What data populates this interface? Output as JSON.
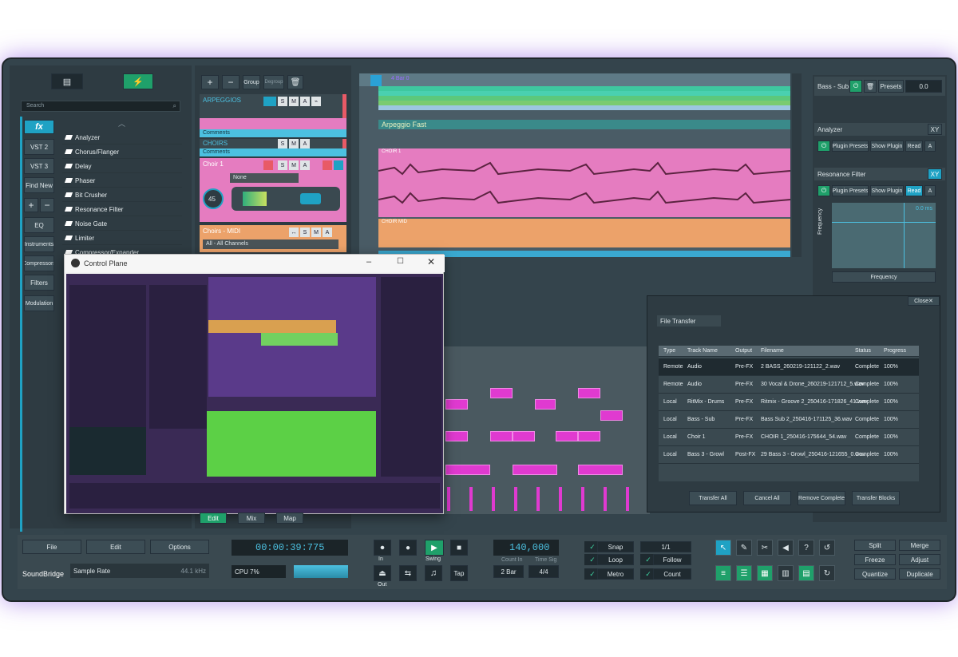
{
  "app": {
    "brand": "SoundBridge",
    "accent": "#1fa2c4",
    "green": "#1fa06a",
    "pink": "#e57cc0",
    "magenta": "#e03ad0"
  },
  "browser": {
    "search_placeholder": "Search",
    "categories": [
      "VST 2",
      "VST 3",
      "Find New",
      "EQ",
      "Instruments",
      "Compressors",
      "Filters",
      "Modulation"
    ],
    "fx_label": "fx",
    "plugins": [
      "Analyzer",
      "Chorus/Flanger",
      "Delay",
      "Phaser",
      "Bit Crusher",
      "Resonance Filter",
      "Noise Gate",
      "Limiter",
      "Compressor/Expander"
    ]
  },
  "tracks_toolbar": {
    "add": "+",
    "remove": "−",
    "group": "Group",
    "degroup": "Degroup",
    "trash": "trash-icon"
  },
  "tracks": {
    "arpeggios": {
      "name": "ARPEGGIOS",
      "comments": "Comments"
    },
    "choirs": {
      "name": "CHOIRS",
      "comments": "Comments"
    },
    "choir1": {
      "name": "Choir 1",
      "input": "None",
      "pan": "45"
    },
    "choirs_midi": {
      "name": "Choirs - MIDI",
      "channels": "All - All Channels"
    },
    "buttons": [
      "S",
      "M",
      "A"
    ]
  },
  "arrange": {
    "loop_label": "4 Bar 0",
    "clip_arpeggio": "Arpeggio Fast",
    "clip_choir": "CHOIR 1",
    "clip_choir_midi": "CHOIR MID"
  },
  "control_plane": {
    "title": "Control Plane"
  },
  "right": {
    "track": "Bass - Sub",
    "presets": "Presets",
    "preset_value": "0.0",
    "analyzer": "Analyzer",
    "xy": "XY",
    "plugin_presets": "Plugin Presets",
    "show_plugin": "Show Plugin",
    "read": "Read",
    "a": "A",
    "resonance": "Resonance Filter",
    "frequency": "Frequency",
    "freq_axis": "Frequency",
    "ms": "0.0 ms"
  },
  "file_transfer": {
    "close": "Close",
    "title": "File Transfer",
    "headers": [
      "Type",
      "Track Name",
      "Output",
      "Filename",
      "Status",
      "Progress"
    ],
    "rows": [
      {
        "type": "Remote",
        "track": "Audio",
        "output": "Pre-FX",
        "file": "2 BASS_260219-121122_2.wav",
        "status": "Complete",
        "progress": "100%"
      },
      {
        "type": "Remote",
        "track": "Audio",
        "output": "Pre-FX",
        "file": "30 Vocal & Drone_260219-121712_5.wav",
        "status": "Complete",
        "progress": "100%"
      },
      {
        "type": "Local",
        "track": "RitMix - Drums",
        "output": "Pre-FX",
        "file": "Ritmix - Groove 2_250416-171826_41.wav",
        "status": "Complete",
        "progress": "100%"
      },
      {
        "type": "Local",
        "track": "Bass - Sub",
        "output": "Pre-FX",
        "file": "Bass Sub 2_250416-171125_36.wav",
        "status": "Complete",
        "progress": "100%"
      },
      {
        "type": "Local",
        "track": "Choir 1",
        "output": "Pre-FX",
        "file": "CHOIR 1_250416-175644_54.wav",
        "status": "Complete",
        "progress": "100%"
      },
      {
        "type": "Local",
        "track": "Bass 3 - Growl",
        "output": "Post-FX",
        "file": "29 Bass 3 - Growl_250416-121655_0.wav",
        "status": "Complete",
        "progress": "100%"
      }
    ],
    "buttons": [
      "Transfer All",
      "Cancel All",
      "Remove Complete",
      "Transfer Blocks"
    ]
  },
  "views": {
    "edit": "Edit",
    "mix": "Mix",
    "map": "Map"
  },
  "bottom": {
    "file": "File",
    "edit": "Edit",
    "options": "Options",
    "sample_rate_label": "Sample Rate",
    "sample_rate": "44.1 kHz",
    "time": "00:00:39:775",
    "cpu": "CPU 7%",
    "in": "In",
    "out": "Out",
    "swing": "Swing",
    "tap": "Tap",
    "tempo": "140,000",
    "count_in": "Count In",
    "time_sig_label": "Time Sig",
    "count_in_value": "2 Bar",
    "time_sig": "4/4",
    "snap": "Snap",
    "snap_value": "1/1",
    "loop": "Loop",
    "follow": "Follow",
    "metro": "Metro",
    "count": "Count",
    "split": "Split",
    "merge": "Merge",
    "freeze": "Freeze",
    "adjust": "Adjust",
    "quantize": "Quantize",
    "duplicate": "Duplicate"
  }
}
